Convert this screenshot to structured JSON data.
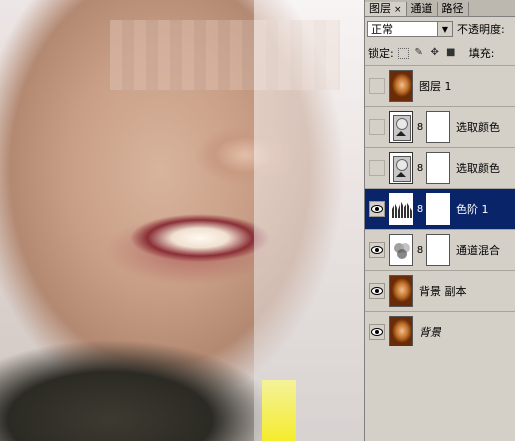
{
  "panel": {
    "tabs": [
      {
        "label": "图层",
        "active": true,
        "close": "×"
      },
      {
        "label": "通道",
        "active": false
      },
      {
        "label": "路径",
        "active": false
      }
    ],
    "blend_mode": "正常",
    "opacity_label": "不透明度:",
    "lock_label": "锁定:",
    "fill_label": "填充:"
  },
  "layers": [
    {
      "name": "图层 1",
      "visible": false,
      "type": "photo"
    },
    {
      "name": "选取颜色",
      "visible": false,
      "type": "selective-color"
    },
    {
      "name": "选取颜色",
      "visible": false,
      "type": "selective-color"
    },
    {
      "name": "色阶 1",
      "visible": true,
      "type": "levels",
      "selected": true
    },
    {
      "name": "通道混合",
      "visible": true,
      "type": "channel-mixer"
    },
    {
      "name": "背景 副本",
      "visible": true,
      "type": "photo"
    },
    {
      "name": "背景",
      "visible": true,
      "type": "photo",
      "italic": true
    }
  ],
  "colors": {
    "panel_bg": "#d4d0c8",
    "selection": "#0a246a"
  }
}
